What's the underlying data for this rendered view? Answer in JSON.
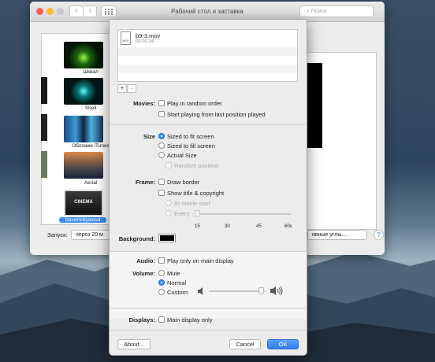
{
  "window": {
    "title": "Рабочий стол и заставка",
    "search_placeholder": "Поиск"
  },
  "savers": [
    {
      "label": "Шквал"
    },
    {
      "label": "Shell"
    },
    {
      "label": "Обложки iTunes"
    },
    {
      "label": "Aerial"
    },
    {
      "label": "SaveHollywood",
      "selected": true,
      "thumb_text": "CINEMA"
    }
  ],
  "bottom_bar": {
    "start_label": "Запуск:",
    "start_value": "через 20 м",
    "corners_button": "ивные углы...",
    "help": "?"
  },
  "sheet": {
    "file": {
      "name": "b9-3.mov",
      "duration": "00:02:24",
      "icon_text": "MOV"
    },
    "add": "+",
    "remove": "−",
    "movies_label": "Movies:",
    "play_random": "Play in random order",
    "start_last": "Start playing from last position played",
    "size_label": "Size",
    "size_fit": "Sized to fit screen",
    "size_fill": "Sized to fill screen",
    "size_actual": "Actual Size",
    "random_position": "Random position",
    "frame_label": "Frame:",
    "draw_border": "Draw border",
    "show_title": "Show title & copyright",
    "at_movie_start": "At movie start",
    "every": "Every:",
    "ticks": [
      "15",
      "30",
      "45",
      "60s"
    ],
    "background_label": "Background:",
    "background_color": "#000000",
    "audio_label": "Audio:",
    "only_main": "Play only on main display",
    "volume_label": "Volume:",
    "mute": "Mute",
    "normal": "Normal",
    "custom": "Custom:",
    "volume_level": 0.92,
    "displays_label": "Displays:",
    "main_only": "Main display only",
    "about_btn": "About...",
    "cancel_btn": "Cancel",
    "ok_btn": "OK"
  },
  "colors": {
    "accent": "#3b8ef0",
    "selection": "#3b8ef0"
  }
}
